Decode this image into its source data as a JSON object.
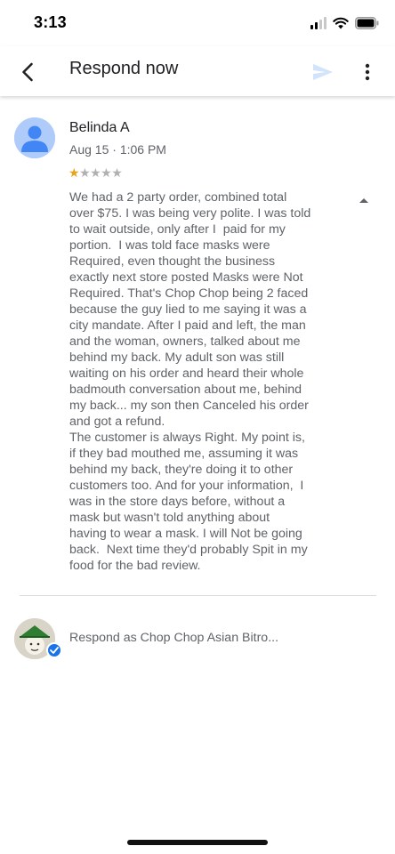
{
  "status_bar": {
    "time": "3:13",
    "icons": [
      "cellular-signal-icon",
      "wifi-icon",
      "battery-icon"
    ]
  },
  "app_bar": {
    "title": "Respond now",
    "icons": [
      "back-arrow-icon",
      "send-icon",
      "more-vert-icon"
    ]
  },
  "review": {
    "reviewer_name": "Belinda A",
    "date": "Aug 15 · 1:06 PM",
    "rating": 1,
    "max_rating": 5,
    "stars_filled": "★",
    "stars_empty": "★★★★",
    "text": "We had a 2 party order, combined total\nover $75. I was being very polite. I was told\nto wait outside, only after I  paid for my\nportion.  I was told face masks were\nRequired, even thought the business\nexactly next store posted Masks were Not\nRequired. That's Chop Chop being 2 faced\nbecause the guy lied to me saying it was a\ncity mandate. After I paid and left, the man\nand the woman, owners, talked about me\nbehind my back. My adult son was still\nwaiting on his order and heard their whole\nbadmouth conversation about me, behind\nmy back... my son then Canceled his order\nand got a refund.\nThe customer is always Right. My point is,\nif they bad mouthed me, assuming it was\nbehind my back, they're doing it to other\ncustomers too. And for your information,  I\nwas in the store days before, without a\nmask but wasn't told anything about\nhaving to wear a mask. I will Not be going\nback.  Next time they'd probably Spit in my\nfood for the bad review."
  },
  "respond": {
    "placeholder": "Respond as Chop Chop Asian Bitro..."
  },
  "colors": {
    "accent": "#1a73e8",
    "star": "#e8a317",
    "avatar_bg": "#aecbfa",
    "avatar_fg": "#4285f4",
    "send_disabled": "#d2e3fc"
  }
}
